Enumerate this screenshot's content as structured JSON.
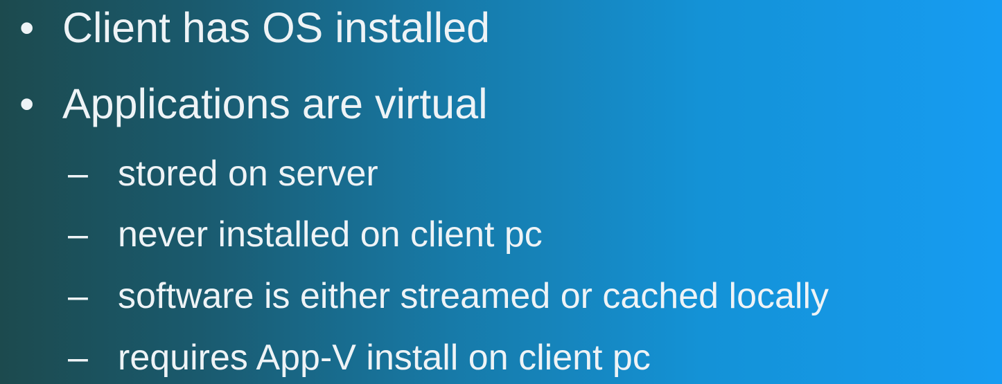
{
  "bullets": [
    {
      "marker": "•",
      "text": "Client has OS installed"
    },
    {
      "marker": "•",
      "text": "Applications are virtual"
    }
  ],
  "sub_bullets": [
    {
      "marker": "–",
      "text": "stored on server"
    },
    {
      "marker": "–",
      "text": "never installed on client pc"
    },
    {
      "marker": "–",
      "text": "software is either streamed or cached locally"
    },
    {
      "marker": "–",
      "text": "requires App-V install on client pc"
    }
  ]
}
